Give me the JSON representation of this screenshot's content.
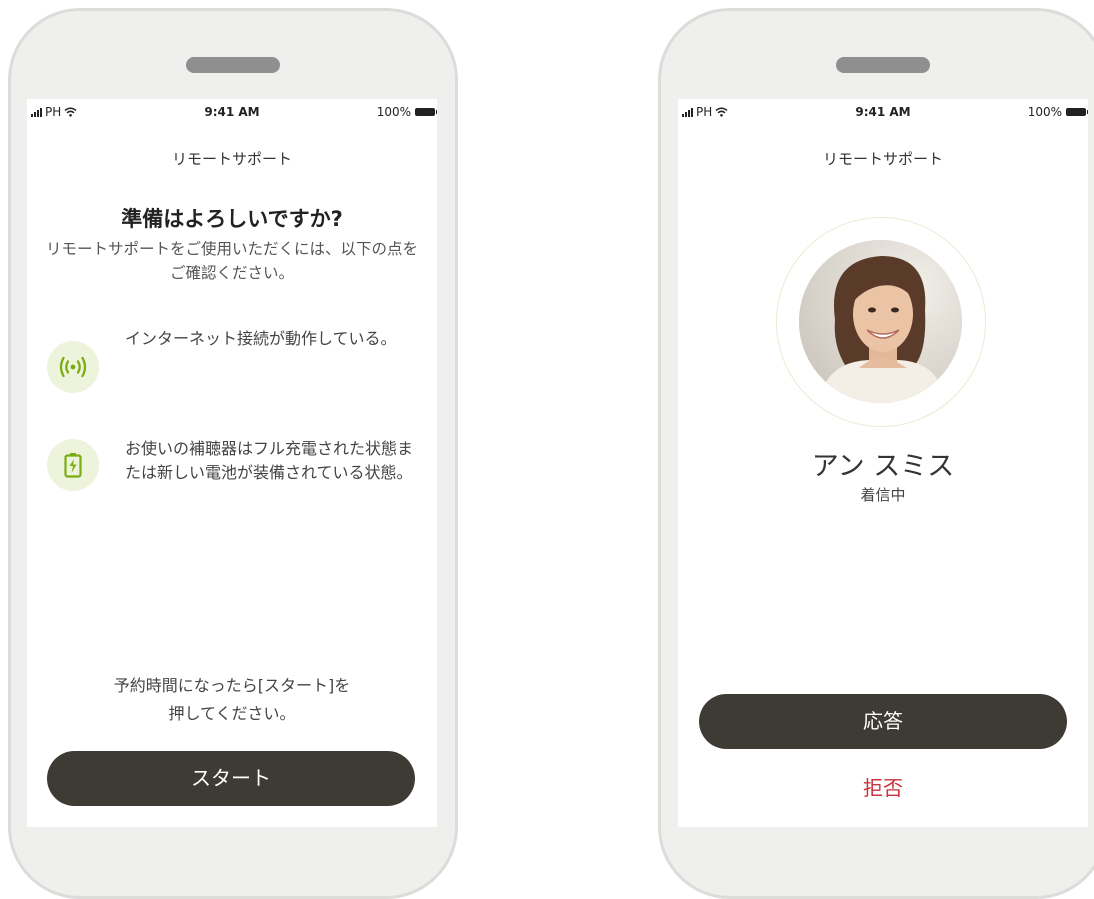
{
  "status_bar": {
    "carrier": "PH",
    "time": "9:41 AM",
    "battery": "100%"
  },
  "left_screen": {
    "nav_title": "リモートサポート",
    "headline": "準備はよろしいですか?",
    "intro": "リモートサポートをご使用いただくには、以下の点をご確認ください。",
    "checklist": [
      {
        "icon": "wireless-signal-icon",
        "text": "インターネット接続が動作している。"
      },
      {
        "icon": "battery-charging-icon",
        "text": "お使いの補聴器はフル充電された状態または新しい電池が装備されている状態。"
      }
    ],
    "notice": "予約時間になったら[スタート]を押してください。",
    "start_button": "スタート"
  },
  "right_screen": {
    "nav_title": "リモートサポート",
    "caller_name": "アン スミス",
    "call_state": "着信中",
    "answer_button": "応答",
    "decline_button": "拒否"
  },
  "colors": {
    "accent_green": "#7aac14",
    "icon_background": "#eef4dc",
    "button_dark": "#3d3b34",
    "decline_red": "#c8333f",
    "phone_frame": "#efefed"
  }
}
